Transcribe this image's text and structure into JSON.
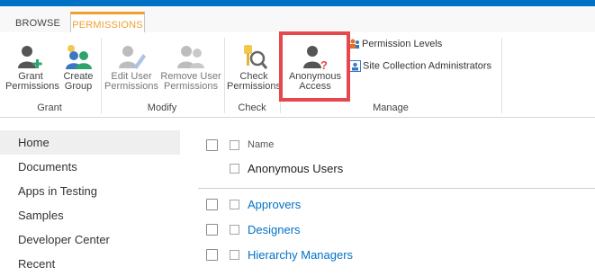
{
  "tabs": {
    "browse": "BROWSE",
    "permissions": "PERMISSIONS"
  },
  "ribbon": {
    "grant": {
      "grant_permissions": [
        "Grant",
        "Permissions"
      ],
      "create_group": [
        "Create",
        "Group"
      ],
      "label": "Grant"
    },
    "modify": {
      "edit_user_permissions": [
        "Edit User",
        "Permissions"
      ],
      "remove_user_permissions": [
        "Remove User",
        "Permissions"
      ],
      "label": "Modify"
    },
    "check": {
      "check_permissions": [
        "Check",
        "Permissions"
      ],
      "label": "Check"
    },
    "manage": {
      "anonymous_access": [
        "Anonymous",
        "Access"
      ],
      "permission_levels": "Permission Levels",
      "site_collection_administrators": "Site Collection Administrators",
      "label": "Manage"
    }
  },
  "leftnav": {
    "items": [
      "Home",
      "Documents",
      "Apps in Testing",
      "Samples",
      "Developer Center",
      "Recent"
    ]
  },
  "list": {
    "header": "Name",
    "first_row": "Anonymous Users",
    "rows": [
      "Approvers",
      "Designers",
      "Hierarchy Managers"
    ]
  },
  "colors": {
    "suite_bar": "#0072c6",
    "accent": "#f0a030",
    "link": "#0072c6",
    "highlight": "#e5484d"
  }
}
